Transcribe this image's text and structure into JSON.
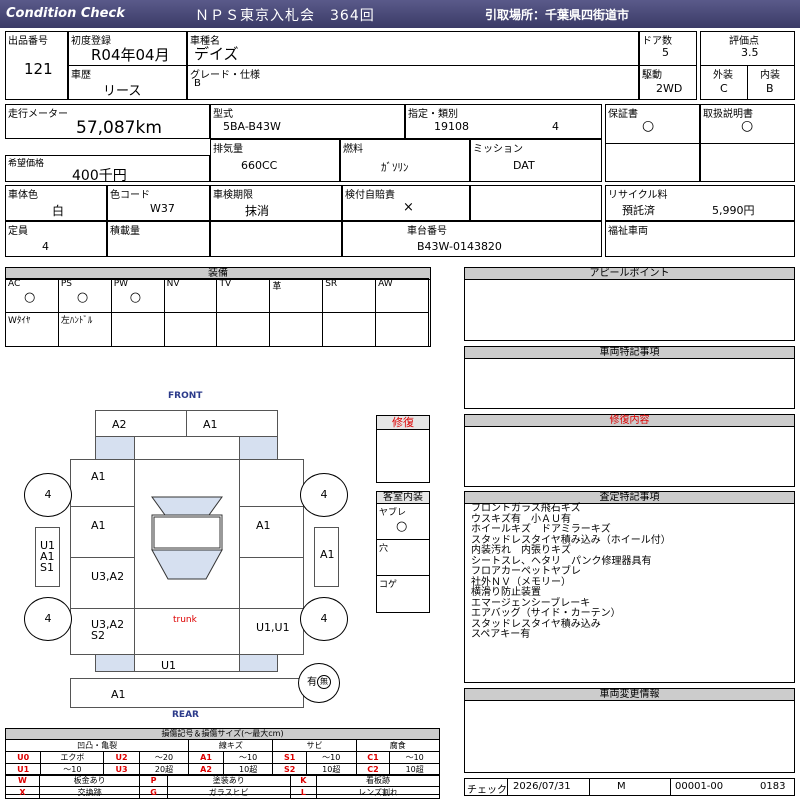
{
  "header": {
    "brand": "Condition  Check",
    "auction": "ＮＰＳ東京入札会　364回",
    "pickup": "引取場所：千葉県四街道市"
  },
  "row1": {
    "lot_label": "出品番号",
    "lot": "121",
    "first_reg_label": "初度登録",
    "first_reg": "R04年04月",
    "car_name_label": "車種名",
    "car_name": "デイズ",
    "doors_label": "ドア数",
    "doors": "5",
    "score_label": "評価点",
    "score": "3.5",
    "history_label": "車歴",
    "history": "リース",
    "grade_label": "グレード・仕様",
    "grade": "B",
    "drive_label": "駆動",
    "drive": "2WD",
    "ext_label": "外装",
    "ext": "C",
    "int_label": "内装",
    "int": "B"
  },
  "row2": {
    "mileage_label": "走行メーター",
    "mileage": "57,087km",
    "model_label": "型式",
    "model": "5BA-B43W",
    "spec_label": "指定・類別",
    "spec1": "19108",
    "spec2": "4",
    "warranty_label": "保証書",
    "warranty": "○",
    "manual_label": "取扱説明書",
    "manual": "○",
    "price_label": "希望価格",
    "price": "400千円",
    "displacement_label": "排気量",
    "displacement": "660CC",
    "fuel_label": "燃料",
    "fuel": "ｶﾞｿﾘﾝ",
    "mission_label": "ミッション",
    "mission": "DAT"
  },
  "row3": {
    "color_label": "車体色",
    "color": "白",
    "color_code_label": "色コード",
    "color_code": "W37",
    "inspection_label": "車検期限",
    "inspection": "抹消",
    "insurance_label": "検付自賠責",
    "insurance": "×",
    "recycle_label": "リサイクル料",
    "recycle_status": "預託済",
    "recycle_fee": "5,990円",
    "capacity_label": "定員",
    "capacity": "4",
    "load_label": "積載量",
    "chassis_label": "車台番号",
    "chassis": "B43W-0143820",
    "welfare_label": "福祉車両"
  },
  "equipment": {
    "title": "装備",
    "row1": [
      {
        "label": "AC",
        "mark": "○"
      },
      {
        "label": "PS",
        "mark": "○"
      },
      {
        "label": "PW",
        "mark": "○"
      },
      {
        "label": "NV",
        "mark": ""
      },
      {
        "label": "TV",
        "mark": ""
      },
      {
        "label": "革",
        "mark": ""
      },
      {
        "label": "SR",
        "mark": ""
      },
      {
        "label": "AW",
        "mark": ""
      }
    ],
    "row2": [
      {
        "label": "Wﾀｲﾔ"
      },
      {
        "label": "左ﾊﾝﾄﾞﾙ"
      },
      {
        "label": ""
      },
      {
        "label": ""
      },
      {
        "label": ""
      },
      {
        "label": ""
      },
      {
        "label": ""
      },
      {
        "label": ""
      }
    ]
  },
  "diagram": {
    "front": "FRONT",
    "rear": "REAR",
    "trunk": "trunk",
    "front_left": "A2",
    "front_right": "A1",
    "fender_left": "A1",
    "door_left_front": "A1",
    "door_left_rear": "U3,A2",
    "quarter_left": "U3,A2\nS2",
    "door_right_front": "A1",
    "quarter_right": "U1,U1",
    "rear_bumper": "U1",
    "rear_bottom": "A1",
    "side_left": "U1\nA1\nS1",
    "side_right": "A1",
    "tire_fl": "4",
    "tire_fr": "4",
    "tire_rl": "4",
    "tire_rr": "4",
    "spare": "有"
  },
  "repair": {
    "title": "修復"
  },
  "interior": {
    "title": "客室内装",
    "items": [
      {
        "label": "ヤブレ",
        "mark": "○"
      },
      {
        "label": "穴",
        "mark": ""
      },
      {
        "label": "コゲ",
        "mark": ""
      }
    ]
  },
  "right_panels": {
    "appeal": "アピールポイント",
    "special": "車両特記事項",
    "repair_detail": "修復内容",
    "inspection_notes": "査定特記事項",
    "change_info": "車両変更情報"
  },
  "notes": [
    "フロントガラス飛石キズ",
    "ウスキズ有　小ＡＵ有",
    "ホイールキズ　ドアミラーキズ",
    "スタッドレスタイヤ積み込み（ホイール付）",
    "内装汚れ　内張りキズ",
    "シートスレ、ヘタリ　パンク修理器具有",
    "フロアカーペットヤブレ",
    "社外ＮＶ（メモリー）",
    "横滑り防止装置",
    "エマージェンシーブレーキ",
    "エアバッグ（サイド・カーテン）",
    "スタッドレスタイヤ積み込み",
    "スペアキー有"
  ],
  "legend": {
    "title": "損傷記号＆損傷サイズ(〜最大cm)",
    "groups": [
      "凹凸・亀裂",
      "線キズ",
      "サビ",
      "腐食"
    ],
    "rows": [
      [
        "U0",
        "エクボ",
        "U2",
        "〜20",
        "A1",
        "〜10",
        "S1",
        "〜10",
        "C1",
        "〜10"
      ],
      [
        "U1",
        "〜10",
        "U3",
        "20超",
        "A2",
        "10超",
        "S2",
        "10超",
        "C2",
        "10超"
      ]
    ],
    "codes": [
      [
        "W",
        "板金あり",
        "P",
        "塗装あり",
        "K",
        "看板跡"
      ],
      [
        "X",
        "交換跡",
        "G",
        "ガラスヒビ",
        "L",
        "レンズ割れ"
      ]
    ]
  },
  "footer": {
    "check_label": "チェック",
    "date": "2026/07/31",
    "mark": "M",
    "code1": "00001-00",
    "code2": "0183"
  }
}
